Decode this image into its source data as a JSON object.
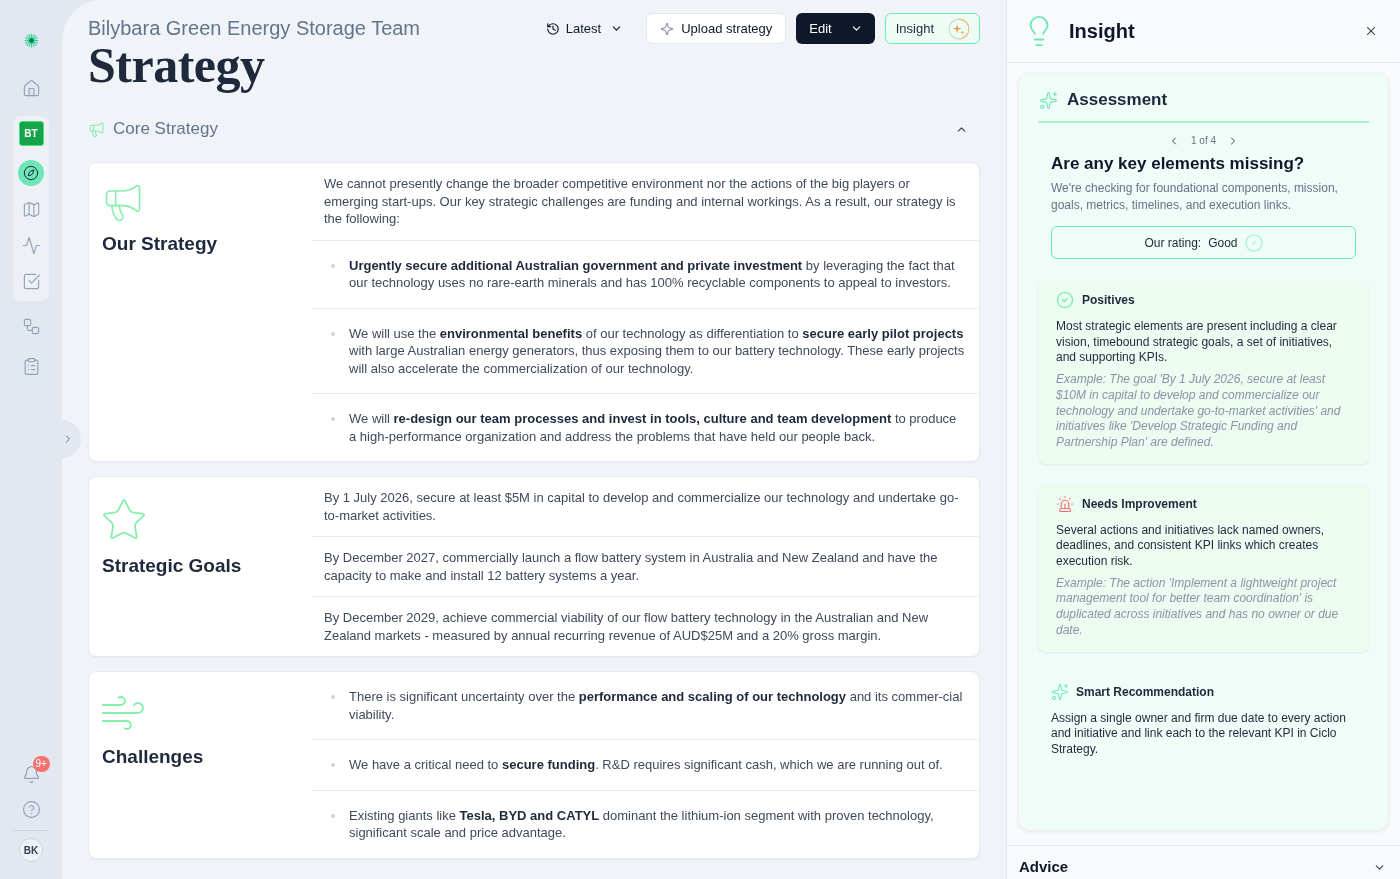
{
  "sidebar": {
    "nav": [
      {
        "selected": false
      },
      {
        "selected": true
      },
      {
        "selected": false
      },
      {
        "selected": false
      },
      {
        "selected": false
      },
      {
        "selected": false
      },
      {
        "selected": false
      }
    ],
    "team_badge": "BT",
    "notifications": "9+",
    "user_initials": "BK"
  },
  "header": {
    "team": "Bilybara Green Energy Storage Team",
    "title": "Strategy",
    "version": "Latest",
    "buttons": [
      {
        "kind": "outline",
        "label": "Upload strategy"
      },
      {
        "kind": "primary",
        "label": "Edit"
      },
      {
        "kind": "insight",
        "label": "Insight"
      }
    ]
  },
  "section": {
    "title": "Core Strategy",
    "expanded": true,
    "cards": [
      {
        "kind": "strategy",
        "title": "Our Strategy",
        "rows": [
          {
            "kind": "text",
            "text": "We cannot presently change the broader competitive environment nor the actions of the big players or emerging start-ups. Our key strategic challenges are funding and internal workings. As a result, our strategy is the following:"
          },
          {
            "kind": "bullet",
            "text": "**Urgently secure additional Australian government and private investment** by leveraging the fact that our technology uses no rare-earth minerals and has 100% recyclable components to appeal to investors."
          },
          {
            "kind": "bullet",
            "text": "We will use the **environmental benefits** of our technology as differentiation to **secure early pilot projects** with large Australian energy generators, thus exposing them to our battery technology. These early projects will also accelerate the commercialization of our technology."
          },
          {
            "kind": "bullet",
            "text": "We will **re-design our team processes and invest in tools, culture and team development** to produce a high-performance organization and address the problems that have held our people back."
          }
        ]
      },
      {
        "kind": "goals",
        "title": "Strategic Goals",
        "rows": [
          {
            "kind": "text",
            "text": "By 1 July 2026, secure at least $5M in capital to develop and commercialize our technology and undertake go-to-market activities."
          },
          {
            "kind": "text",
            "text": "By December 2027, commercially launch a flow battery system in Australia and New Zealand and have the capacity to make and install 12 battery systems a year."
          },
          {
            "kind": "text",
            "text": "By December 2029, achieve commercial viability of our flow battery technology in the Australian and New Zealand markets - measured by annual recurring revenue of AUD$25M and a 20% gross margin."
          }
        ]
      },
      {
        "kind": "challenges",
        "title": "Challenges",
        "rows": [
          {
            "kind": "bullet",
            "text": "There is significant uncertainty over the **performance and scaling of our technology** and its commer-cial viability."
          },
          {
            "kind": "bullet",
            "text": "We have a critical need to **secure funding**. R&D requires significant cash, which we are running out of."
          },
          {
            "kind": "bullet",
            "text": "Existing giants like **Tesla, BYD and CATYL** dominant the lithium-ion segment with proven technology, significant scale and price advantage."
          }
        ]
      }
    ]
  },
  "insight_panel": {
    "title": "Insight",
    "assessment": {
      "title": "Assessment",
      "pager": "1 of 4",
      "question": "Are any key elements missing?",
      "description": "We're checking for foundational components, mission, goals, metrics, timelines, and execution links.",
      "rating_label": "Our rating:",
      "rating": "Good",
      "findings": [
        {
          "kind": "positive",
          "title": "Positives",
          "text": "Most strategic elements are present including a clear vision, timebound strategic goals, a set of initiatives, and supporting KPIs.",
          "example": "Example: The goal 'By 1 July 2026, secure at least $10M in capital to develop and commercialize our technology and undertake go-to-market activities' and initiatives like 'Develop Strategic Funding and Partnership Plan' are defined."
        },
        {
          "kind": "improvement",
          "title": "Needs Improvement",
          "text": "Several actions and initiatives lack named owners, deadlines, and consistent KPI links which creates execution risk.",
          "example": "Example: The action 'Implement a lightweight project management tool for better team coordination' is duplicated across initiatives and has no owner or due date."
        }
      ],
      "recommendation": {
        "title": "Smart Recommendation",
        "text": "Assign a single owner and firm due date to every action and initiative and link each to the relevant KPI in Ciclo Strategy."
      }
    },
    "advice": {
      "title": "Advice",
      "expanded": false
    }
  }
}
